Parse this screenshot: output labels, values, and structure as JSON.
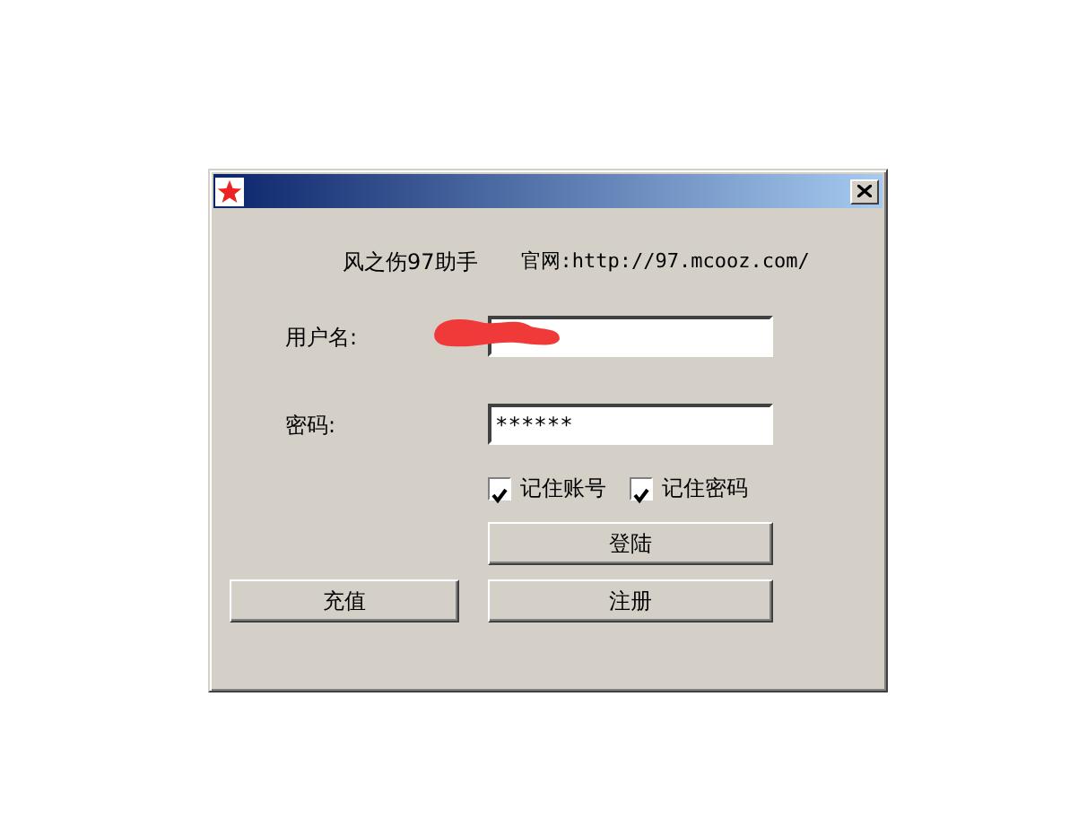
{
  "header": {
    "app_name": "风之伤97助手",
    "website": "官网:http://97.mcooz.com/"
  },
  "fields": [
    {
      "label": "用户名:",
      "redacted": true
    },
    {
      "label": "密码:",
      "value": "******"
    }
  ],
  "checkboxes": [
    {
      "label": "记住账号",
      "checked": true
    },
    {
      "label": "记住密码",
      "checked": true
    }
  ],
  "buttons": [
    {
      "label": "登陆"
    },
    {
      "label": "充值"
    },
    {
      "label": "注册"
    }
  ]
}
